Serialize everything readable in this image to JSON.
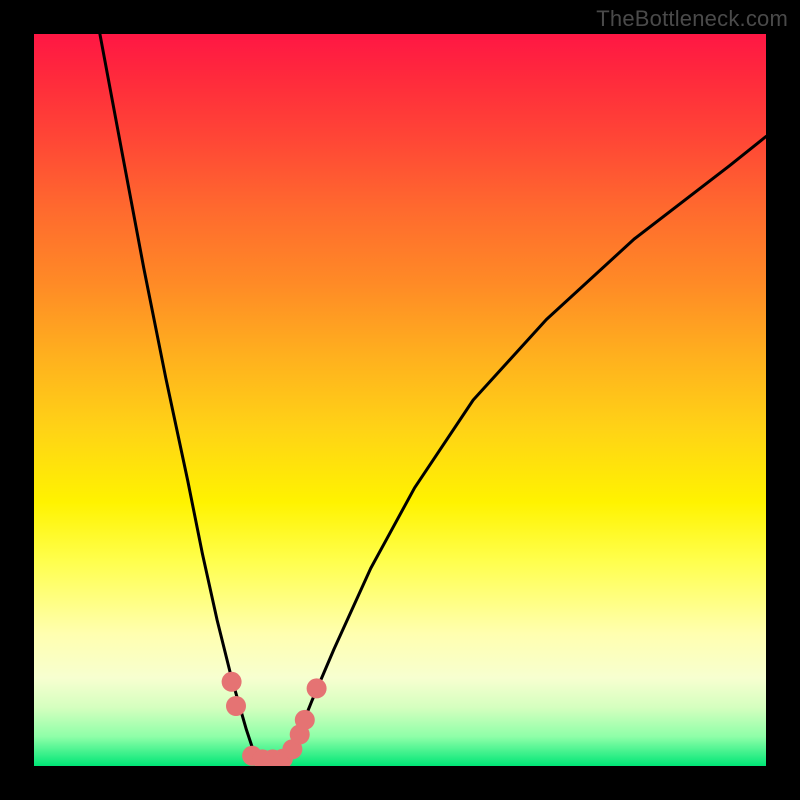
{
  "watermark": "TheBottleneck.com",
  "colors": {
    "background": "#000000",
    "gradient_top": "#ff1744",
    "gradient_mid": "#fff300",
    "gradient_bottom": "#00e676",
    "curve": "#000000",
    "marker": "#e57373"
  },
  "chart_data": {
    "type": "line",
    "title": "",
    "xlabel": "",
    "ylabel": "",
    "xlim": [
      0,
      100
    ],
    "ylim": [
      0,
      100
    ],
    "grid": false,
    "legend": false,
    "series": [
      {
        "name": "bottleneck-curve",
        "x": [
          9,
          12,
          15,
          18,
          21,
          23,
          25,
          27,
          29,
          30,
          31,
          32.5,
          34,
          36,
          38,
          41,
          46,
          52,
          60,
          70,
          82,
          95,
          100
        ],
        "y": [
          100,
          84,
          68,
          53,
          39,
          29,
          20,
          12,
          5,
          2,
          0,
          0,
          1,
          4,
          9,
          16,
          27,
          38,
          50,
          61,
          72,
          82,
          86
        ]
      }
    ],
    "markers": [
      {
        "x": 27.0,
        "y": 11.5
      },
      {
        "x": 27.6,
        "y": 8.2
      },
      {
        "x": 29.8,
        "y": 1.4
      },
      {
        "x": 31.2,
        "y": 0.9
      },
      {
        "x": 32.6,
        "y": 0.9
      },
      {
        "x": 34.0,
        "y": 1.0
      },
      {
        "x": 35.3,
        "y": 2.3
      },
      {
        "x": 36.3,
        "y": 4.3
      },
      {
        "x": 37.0,
        "y": 6.3
      },
      {
        "x": 38.6,
        "y": 10.6
      }
    ]
  }
}
